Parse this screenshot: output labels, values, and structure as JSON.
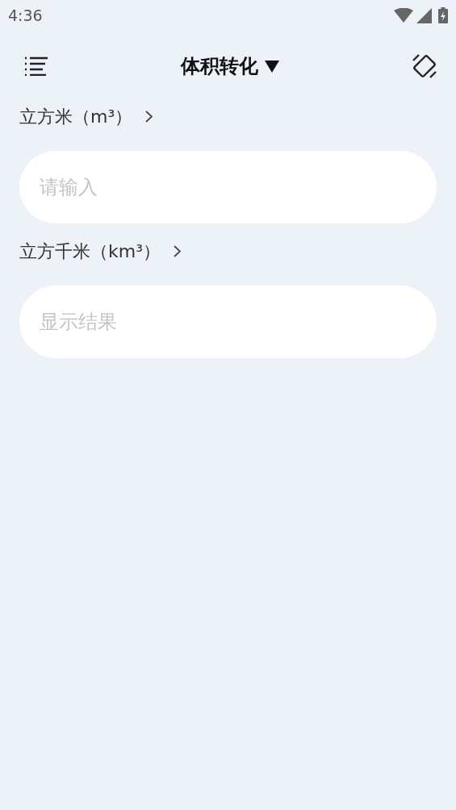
{
  "status_bar": {
    "time": "4:36"
  },
  "app_bar": {
    "title": "体积转化"
  },
  "conversions": [
    {
      "unit": "立方米（m³）",
      "field": {
        "placeholder": "请输入"
      }
    },
    {
      "unit": "立方千米（km³）",
      "field": {
        "placeholder": "显示结果"
      }
    }
  ]
}
